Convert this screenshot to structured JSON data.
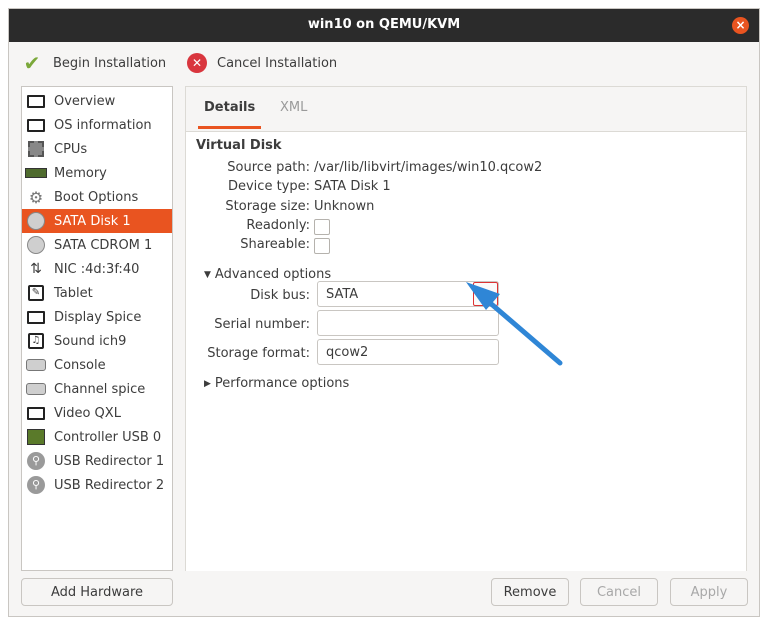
{
  "window": {
    "title": "win10 on QEMU/KVM",
    "close_symbol": "×"
  },
  "toolbar": {
    "begin_label": "Begin Installation",
    "cancel_label": "Cancel Installation",
    "begin_icon": "check-icon",
    "cancel_icon": "cancel-icon"
  },
  "sidebar": {
    "items": [
      {
        "label": "Overview",
        "icon": "monitor-icon"
      },
      {
        "label": "OS information",
        "icon": "monitor-icon"
      },
      {
        "label": "CPUs",
        "icon": "chip-icon"
      },
      {
        "label": "Memory",
        "icon": "memory-icon"
      },
      {
        "label": "Boot Options",
        "icon": "gear-icon"
      },
      {
        "label": "SATA Disk 1",
        "icon": "disk-icon",
        "selected": true
      },
      {
        "label": "SATA CDROM 1",
        "icon": "cdrom-icon"
      },
      {
        "label": "NIC :4d:3f:40",
        "icon": "network-icon"
      },
      {
        "label": "Tablet",
        "icon": "tablet-icon"
      },
      {
        "label": "Display Spice",
        "icon": "monitor-icon"
      },
      {
        "label": "Sound ich9",
        "icon": "sound-icon"
      },
      {
        "label": "Console",
        "icon": "console-icon"
      },
      {
        "label": "Channel spice",
        "icon": "console-icon"
      },
      {
        "label": "Video QXL",
        "icon": "monitor-icon"
      },
      {
        "label": "Controller USB 0",
        "icon": "pcb-icon"
      },
      {
        "label": "USB Redirector 1",
        "icon": "usb-icon"
      },
      {
        "label": "USB Redirector 2",
        "icon": "usb-icon"
      }
    ]
  },
  "tabs": {
    "details": "Details",
    "xml": "XML"
  },
  "disk": {
    "section_title": "Virtual Disk",
    "source_path_label": "Source path:",
    "source_path": "/var/lib/libvirt/images/win10.qcow2",
    "device_type_label": "Device type:",
    "device_type": "SATA Disk 1",
    "storage_size_label": "Storage size:",
    "storage_size": "Unknown",
    "readonly_label": "Readonly:",
    "readonly_checked": false,
    "shareable_label": "Shareable:",
    "shareable_checked": false
  },
  "advanced": {
    "label": "Advanced options",
    "disk_bus_label": "Disk bus:",
    "disk_bus_value": "SATA",
    "serial_label": "Serial number:",
    "serial_value": "",
    "format_label": "Storage format:",
    "format_value": "qcow2",
    "performance_label": "Performance options"
  },
  "footer": {
    "add_hardware": "Add Hardware",
    "remove": "Remove",
    "cancel": "Cancel",
    "apply": "Apply"
  },
  "colors": {
    "accent": "#e95420",
    "annotation_arrow": "#2f86d6"
  }
}
